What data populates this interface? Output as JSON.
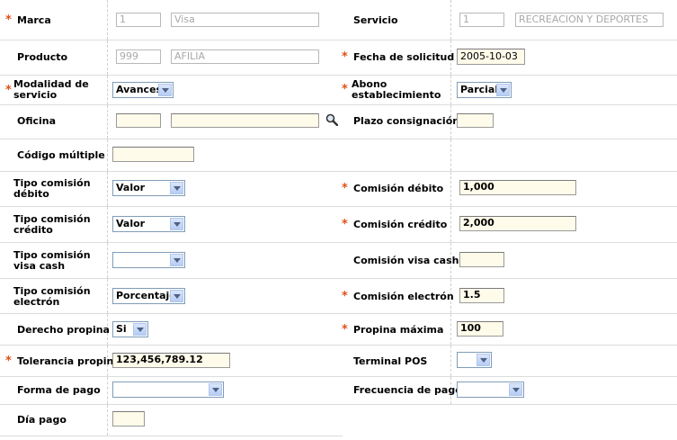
{
  "fields": {
    "marca": {
      "label": "Marca",
      "code": "1",
      "name": "Visa"
    },
    "servicio": {
      "label": "Servicio",
      "code": "1",
      "name": "RECREACION Y DEPORTES"
    },
    "producto": {
      "label": "Producto",
      "code": "999",
      "name": "AFILIA"
    },
    "fecha_solicitud": {
      "label": "Fecha de solicitud",
      "value": "2005-10-03"
    },
    "modalidad_servicio": {
      "label": "Modalidad de servicio",
      "value": "Avances"
    },
    "abono_establecimiento": {
      "label": "Abono establecimiento",
      "value": "Parcial"
    },
    "oficina": {
      "label": "Oficina",
      "code": "",
      "name": "",
      "search_icon": "magnifier-icon"
    },
    "plazo_consignacion": {
      "label": "Plazo consignación",
      "value": ""
    },
    "codigo_multiple": {
      "label": "Código múltiple",
      "value": ""
    },
    "tipo_comision_debito": {
      "label": "Tipo comisión débito",
      "value": "Valor"
    },
    "comision_debito": {
      "label": "Comisión débito",
      "value": "1,000"
    },
    "tipo_comision_credito": {
      "label": "Tipo comisión crédito",
      "value": "Valor"
    },
    "comision_credito": {
      "label": "Comisión crédito",
      "value": "2,000"
    },
    "tipo_comision_visa_cash": {
      "label": "Tipo comisión visa cash",
      "value": ""
    },
    "comision_visa_cash": {
      "label": "Comisión visa cash",
      "value": ""
    },
    "tipo_comision_electron": {
      "label": "Tipo comisión electrón",
      "value": "Porcentaje"
    },
    "comision_electron": {
      "label": "Comisión electrón",
      "value": "1.5"
    },
    "derecho_propina": {
      "label": "Derecho propina",
      "value": "Si"
    },
    "propina_maxima": {
      "label": "Propina máxima",
      "value": "100"
    },
    "tolerancia_propina": {
      "label": "Tolerancia propina",
      "value": "123,456,789.12"
    },
    "terminal_pos": {
      "label": "Terminal POS",
      "value": ""
    },
    "forma_pago": {
      "label": "Forma de pago",
      "value": ""
    },
    "frecuencia_pago": {
      "label": "Frecuencia de pago",
      "value": ""
    },
    "dia_pago": {
      "label": "Día pago",
      "value": ""
    }
  },
  "required_marker": "*",
  "colors": {
    "required": "#e0501a",
    "input_bg": "#fffbea",
    "select_border": "#7f9db9"
  }
}
